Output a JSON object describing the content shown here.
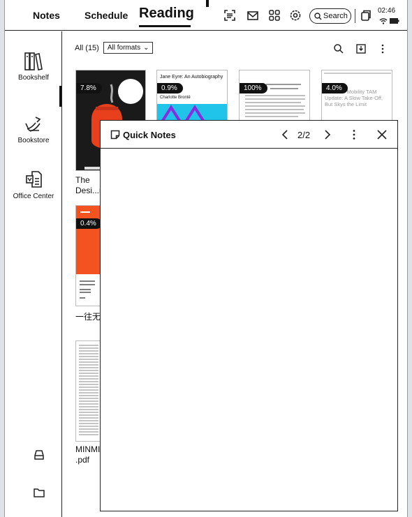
{
  "topbar": {
    "tabs": [
      "Notes",
      "Schedule",
      "Reading"
    ],
    "active_tab": "Reading",
    "icons": [
      "scan-icon",
      "mail-icon",
      "apps-grid-icon",
      "settings-icon"
    ],
    "search_label": "Search",
    "time": "02:46"
  },
  "sidebar": {
    "items": [
      {
        "label": "Bookshelf",
        "icon": "bookshelf-icon"
      },
      {
        "label": "Bookstore",
        "icon": "bookstore-icon"
      },
      {
        "label": "Office Center",
        "icon": "office-center-icon"
      }
    ],
    "bottom_icons": [
      "storage-icon",
      "folder-icon"
    ]
  },
  "library": {
    "count_label": "All (15)",
    "format_filter": "All formats",
    "books": [
      {
        "progress": "7.8%",
        "title": "The\nDesi...n"
      },
      {
        "progress": "0.9%",
        "cover_title": "Jane Eyre: An Autobiography",
        "cover_author": "Charlotte Brontë"
      },
      {
        "progress": "100%"
      },
      {
        "progress": "4.0%",
        "cover_text": "...ban Air Mobility TAM Update: A Slow Take-Off, But Skys the Limit"
      },
      {
        "progress": "0.4%",
        "title": "一往无"
      },
      {
        "title": "MINMI\n.pdf"
      }
    ]
  },
  "quick_notes": {
    "title": "Quick Notes",
    "page": "2/2"
  },
  "colors": {
    "accent": "#111111",
    "cover_red": "#e8401c",
    "cover_cyan": "#1fc4e8",
    "cover_purple": "#8a2be2"
  }
}
